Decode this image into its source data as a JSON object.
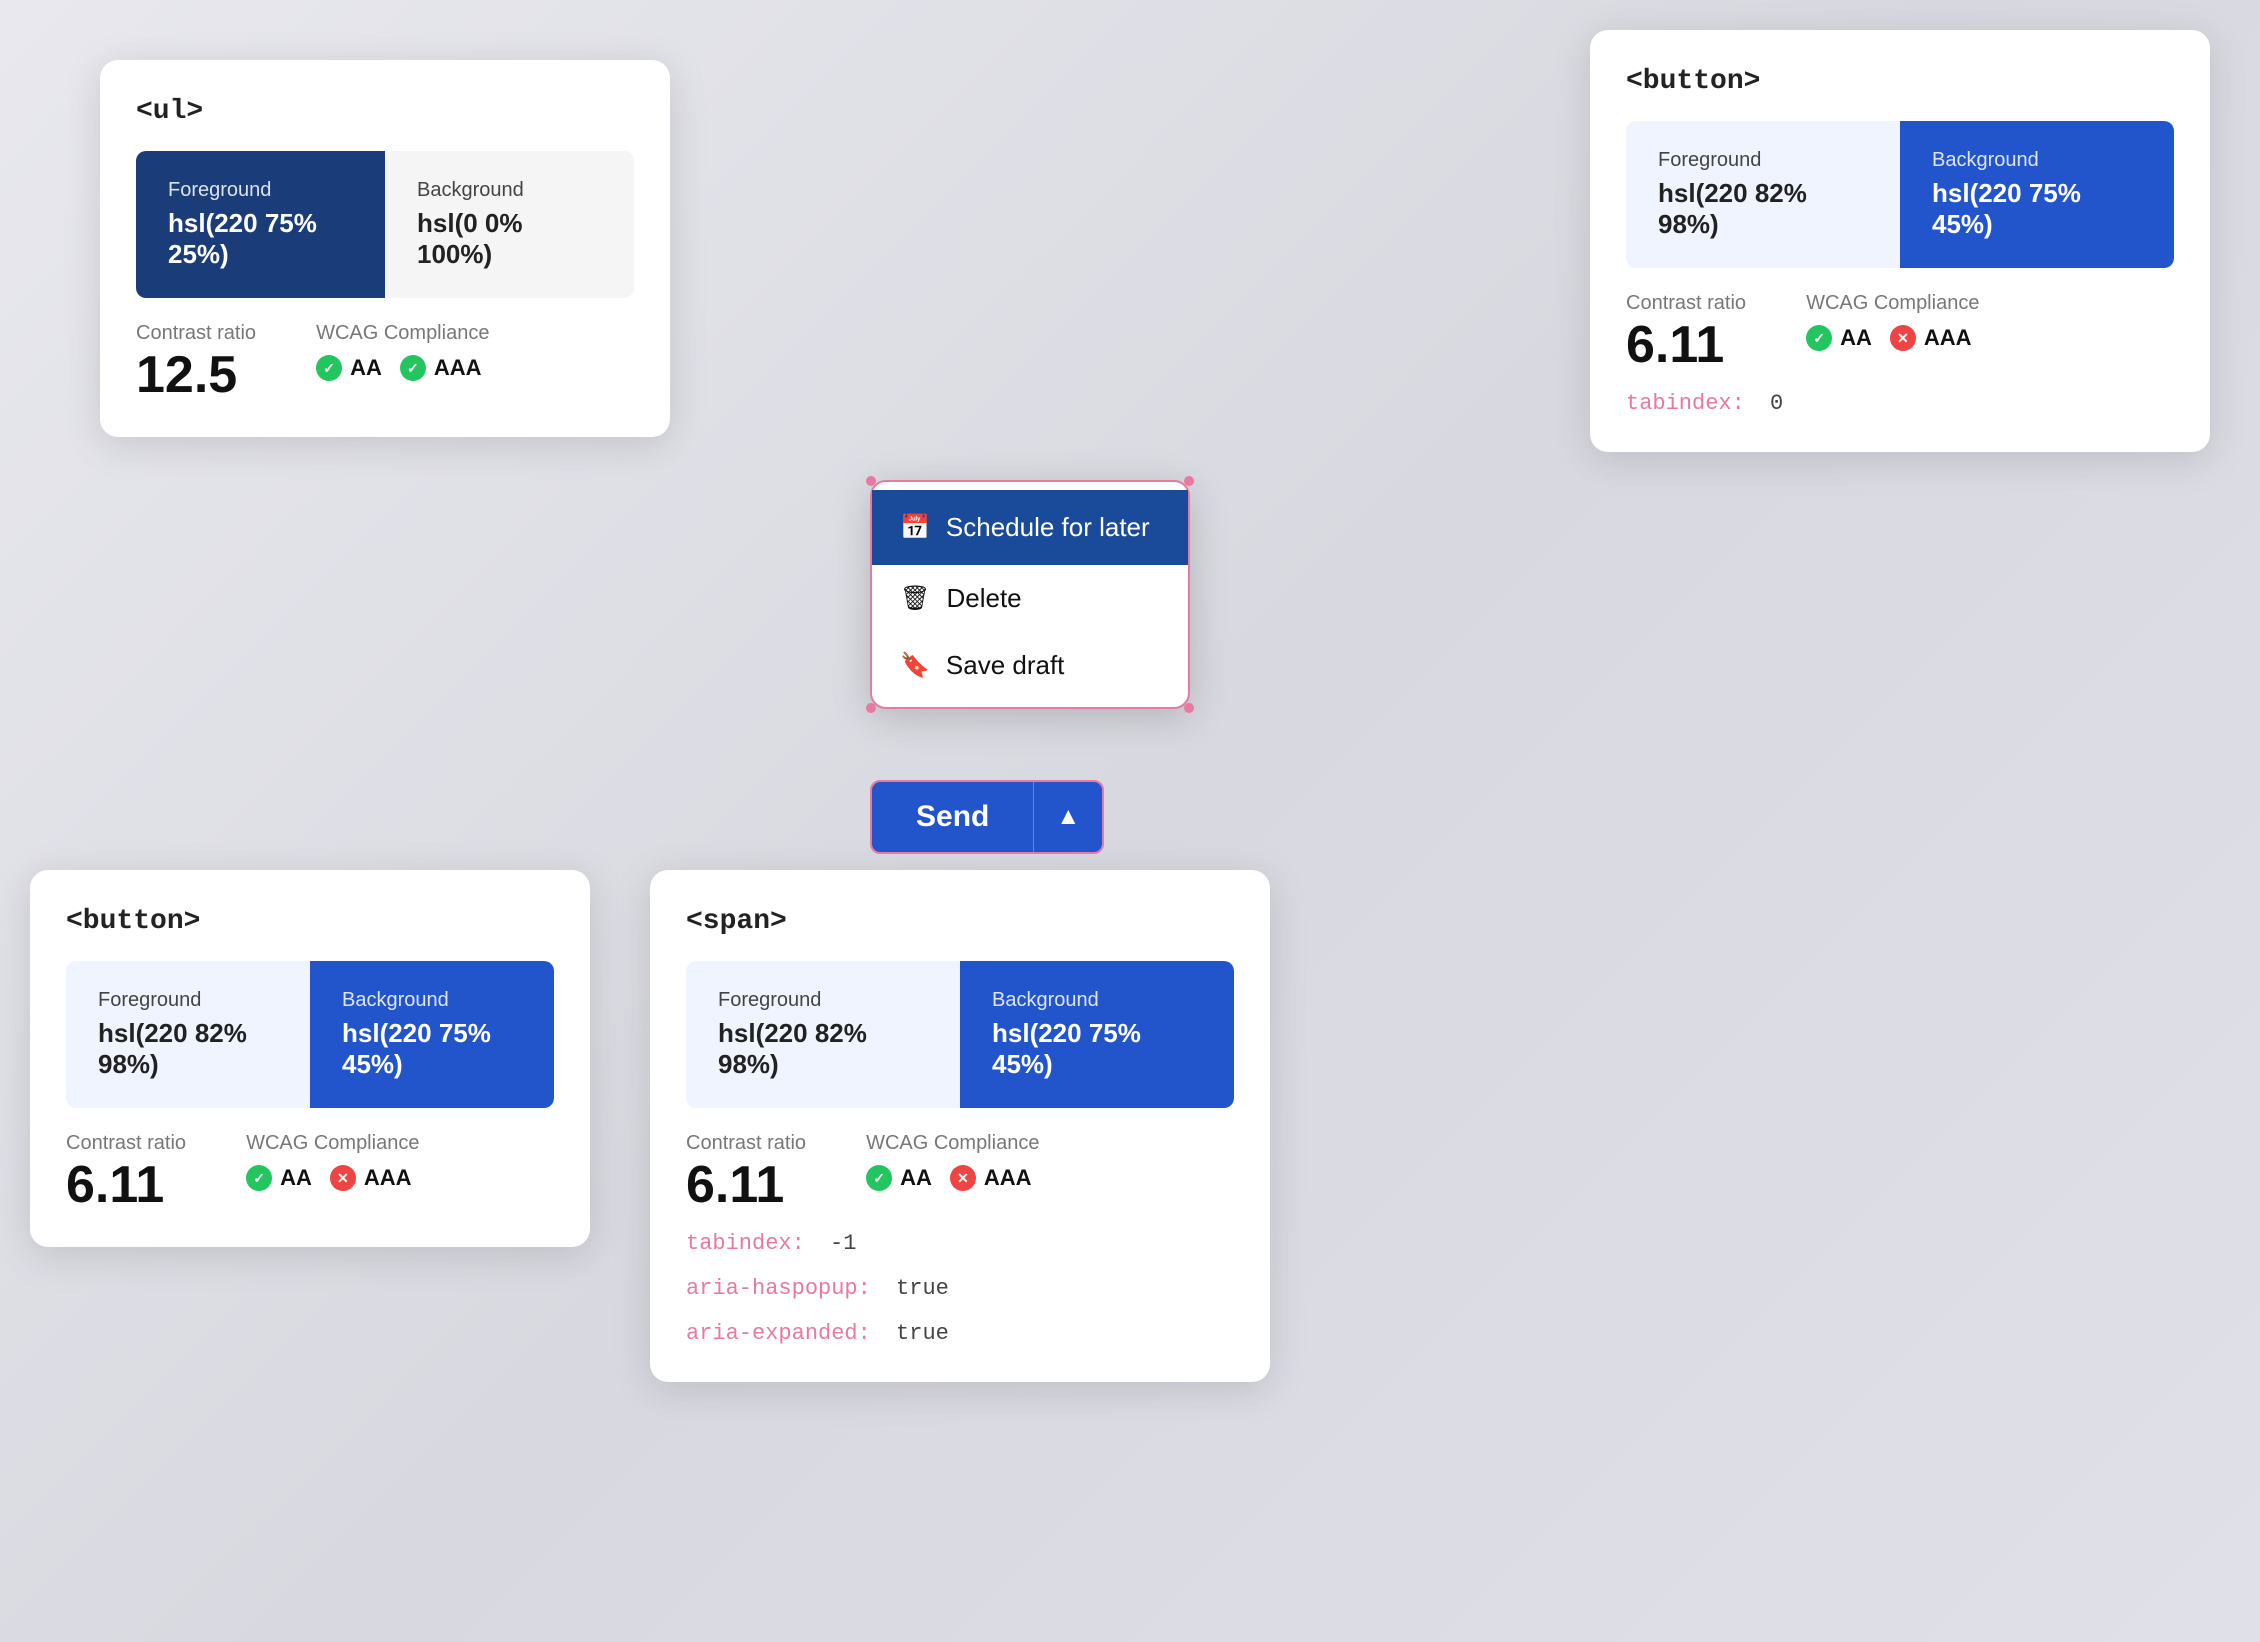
{
  "cards": {
    "ul_card": {
      "title": "<ul>",
      "foreground_label": "Foreground",
      "foreground_value": "hsl(220 75% 25%)",
      "background_label": "Background",
      "background_value": "hsl(0 0% 100%)",
      "fg_color": "#1a3d7a",
      "bg_color": "#ffffff",
      "contrast_label": "Contrast ratio",
      "contrast_value": "12.5",
      "wcag_label": "WCAG Compliance",
      "aa_label": "AA",
      "aaa_label": "AAA",
      "aa_pass": true,
      "aaa_pass": true
    },
    "button_card_top": {
      "title": "<button>",
      "foreground_label": "Foreground",
      "foreground_value": "hsl(220 82% 98%)",
      "background_label": "Background",
      "background_value": "hsl(220 75% 45%)",
      "fg_color": "#f0f4ff",
      "bg_color": "#2255cc",
      "contrast_label": "Contrast ratio",
      "contrast_value": "6.11",
      "wcag_label": "WCAG Compliance",
      "aa_label": "AA",
      "aaa_label": "AAA",
      "aa_pass": true,
      "aaa_pass": false,
      "tabindex_label": "tabindex:",
      "tabindex_value": "0"
    },
    "button_card_bottom": {
      "title": "<button>",
      "foreground_label": "Foreground",
      "foreground_value": "hsl(220 82% 98%)",
      "background_label": "Background",
      "background_value": "hsl(220 75% 45%)",
      "fg_color": "#f0f4ff",
      "bg_color": "#2255cc",
      "contrast_label": "Contrast ratio",
      "contrast_value": "6.11",
      "wcag_label": "WCAG Compliance",
      "aa_label": "AA",
      "aaa_label": "AAA",
      "aa_pass": true,
      "aaa_pass": false
    },
    "span_card": {
      "title": "<span>",
      "foreground_label": "Foreground",
      "foreground_value": "hsl(220 82% 98%)",
      "background_label": "Background",
      "background_value": "hsl(220 75% 45%)",
      "fg_color": "#f0f4ff",
      "bg_color": "#2255cc",
      "contrast_label": "Contrast ratio",
      "contrast_value": "6.11",
      "wcag_label": "WCAG Compliance",
      "aa_label": "AA",
      "aaa_label": "AAA",
      "aa_pass": true,
      "aaa_pass": false,
      "tabindex_label": "tabindex:",
      "tabindex_value": "-1",
      "aria_haspopup_label": "aria-haspopup:",
      "aria_haspopup_value": "true",
      "aria_expanded_label": "aria-expanded:",
      "aria_expanded_value": "true"
    }
  },
  "dropdown": {
    "items": [
      {
        "label": "Schedule for later",
        "icon": "calendar"
      },
      {
        "label": "Delete",
        "icon": "trash"
      },
      {
        "label": "Save draft",
        "icon": "bookmark"
      }
    ]
  },
  "send_button": {
    "label": "Send",
    "chevron": "▲"
  }
}
